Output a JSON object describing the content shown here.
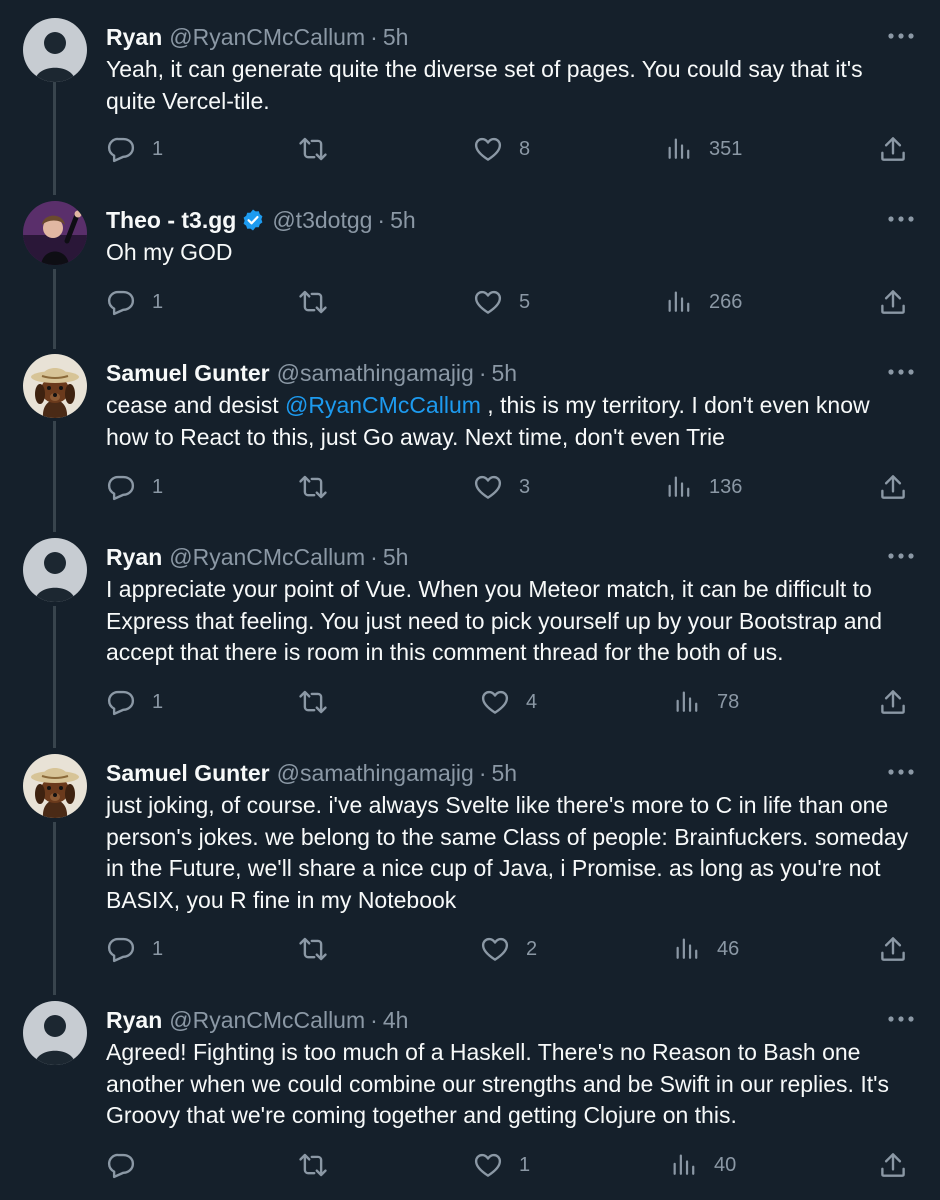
{
  "colors": {
    "background": "#15202b",
    "text_primary": "#f7f9f9",
    "text_secondary": "#8b98a5",
    "link": "#1d9bf0",
    "verified_badge": "#1d9bf0",
    "thread_line": "#38444d"
  },
  "icons": {
    "reply": "speech-bubble-icon",
    "retweet": "retweet-arrows-icon",
    "like": "heart-icon",
    "views": "bar-chart-icon",
    "share": "upload-arrow-icon",
    "more": "more-dots-icon",
    "verified": "verified-badge-icon"
  },
  "tweets": [
    {
      "name": "Ryan",
      "handle": "@RyanCMcCallum",
      "separator": "·",
      "time": "5h",
      "text_parts": [
        "Yeah, it can generate quite the diverse set of pages. You could say that it's quite Vercel-tile."
      ],
      "replies": "1",
      "retweets": "",
      "likes": "8",
      "views": "351"
    },
    {
      "name": "Theo - t3.gg",
      "handle": "@t3dotgg",
      "separator": "·",
      "time": "5h",
      "text_parts": [
        "Oh my GOD"
      ],
      "replies": "1",
      "retweets": "",
      "likes": "5",
      "views": "266"
    },
    {
      "name": "Samuel Gunter",
      "handle": "@samathingamajig",
      "separator": "·",
      "time": "5h",
      "text_parts": [
        "cease and desist ",
        "@RyanCMcCallum",
        " , this is my territory. I don't even know how to React to this, just Go away. Next time, don't even Trie"
      ],
      "replies": "1",
      "retweets": "",
      "likes": "3",
      "views": "136"
    },
    {
      "name": "Ryan",
      "handle": "@RyanCMcCallum",
      "separator": "·",
      "time": "5h",
      "text_parts": [
        "I appreciate your point of Vue. When you Meteor match, it can be difficult to Express that feeling. You just need to pick yourself up by your Bootstrap and accept that there is room in this comment thread for the both of us."
      ],
      "replies": "1",
      "retweets": "",
      "likes": "4",
      "views": "78"
    },
    {
      "name": "Samuel Gunter",
      "handle": "@samathingamajig",
      "separator": "·",
      "time": "5h",
      "text_parts": [
        "just joking, of course. i've always Svelte like there's more to C in life than one person's jokes. we belong to the same Class of people: Brainfuckers. someday in the Future, we'll share a nice cup of Java, i Promise. as long as you're not BASIX, you R fine in my Notebook"
      ],
      "replies": "1",
      "retweets": "",
      "likes": "2",
      "views": "46"
    },
    {
      "name": "Ryan",
      "handle": "@RyanCMcCallum",
      "separator": "·",
      "time": "4h",
      "text_parts": [
        "Agreed! Fighting is too much of a Haskell. There's no Reason to Bash one another when we could combine our strengths and be Swift in our replies. It's Groovy that we're coming together and getting Clojure on this."
      ],
      "replies": "",
      "retweets": "",
      "likes": "1",
      "views": "40"
    }
  ]
}
